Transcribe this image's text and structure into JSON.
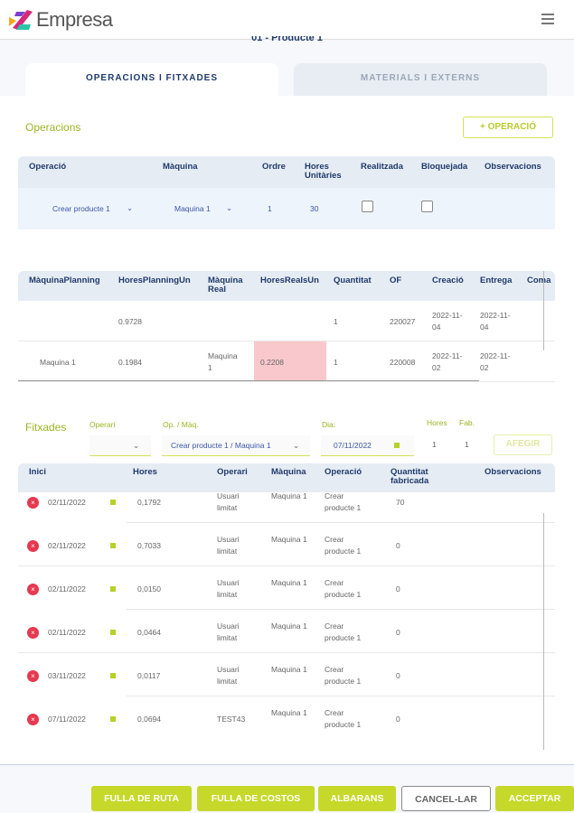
{
  "app": {
    "brand": "Empresa",
    "subtitle": "01 - Producte 1"
  },
  "tabs": [
    {
      "label": "OPERACIONS I FITXADES",
      "active": true
    },
    {
      "label": "MATERIALS I EXTERNS",
      "active": false
    }
  ],
  "operacions": {
    "title": "Operacions",
    "add_button": "+ OPERACIÓ",
    "columns": [
      "Operació",
      "Màquina",
      "Ordre",
      "Hores Unitàries",
      "Realitzada",
      "Bloquejada",
      "Observacions"
    ],
    "row": {
      "operacio": "Crear producte 1",
      "maquina": "Maquina 1",
      "ordre": "1",
      "hores": "30",
      "realitzada": false,
      "bloquejada": false
    }
  },
  "planning": {
    "columns": [
      "MàquinaPlanning",
      "HoresPlanningUn",
      "Màquina Real",
      "HoresRealsUn",
      "Quantitat",
      "OF",
      "Creació",
      "Entrega",
      "Coma"
    ],
    "rows": [
      [
        "",
        "0.9728",
        "",
        "",
        "1",
        "220027",
        "2022-11-04",
        "2022-11-04",
        ""
      ],
      [
        "Maquina 1",
        "0.1984",
        "Maquina 1",
        "0.2208",
        "1",
        "220008",
        "2022-11-02",
        "2022-11-02",
        ""
      ]
    ],
    "highlight_color": "#f8c8cc"
  },
  "fitxades": {
    "title": "Fitxades",
    "operari_label": "Operari",
    "operari_value": "",
    "opmaq_label": "Op. / Màq.",
    "opmaq_value": "Crear producte 1 / Maquina 1",
    "dia_label": "Dia:",
    "dia_value": "07/11/2022",
    "hores_label": "Hores",
    "hores_value": "1",
    "fab_label": "Fab.",
    "fab_value": "1",
    "add_button": "AFEGIR",
    "columns": [
      "Inici",
      "Hores",
      "Operari",
      "Màquina",
      "Operació",
      "Quantitat fabricada",
      "Observacions"
    ],
    "rows": [
      [
        "02/11/2022",
        "0,1792",
        "Usuari limitat",
        "Maquina 1",
        "Crear producte 1",
        "70"
      ],
      [
        "02/11/2022",
        "0,7033",
        "Usuari limitat",
        "Maquina 1",
        "Crear producte 1",
        "0"
      ],
      [
        "02/11/2022",
        "0,0150",
        "Usuari limitat",
        "Maquina 1",
        "Crear producte 1",
        "0"
      ],
      [
        "02/11/2022",
        "0,0464",
        "Usuari limitat",
        "Maquina 1",
        "Crear producte 1",
        "0"
      ],
      [
        "03/11/2022",
        "0,0117",
        "Usuari limitat",
        "Maquina 1",
        "Crear producte 1",
        "0"
      ],
      [
        "07/11/2022",
        "0,0694",
        "TEST43",
        "Maquina 1",
        "Crear producte 1",
        "0"
      ]
    ]
  },
  "footer": {
    "buttons": [
      "FULLA DE RUTA",
      "FULLA DE COSTOS",
      "ALBARANS",
      "CANCEL-LAR",
      "ACCEPTAR"
    ]
  },
  "colors": {
    "accent": "#c6d82a",
    "header_text": "#1f3a6b",
    "delete": "#e53950"
  }
}
